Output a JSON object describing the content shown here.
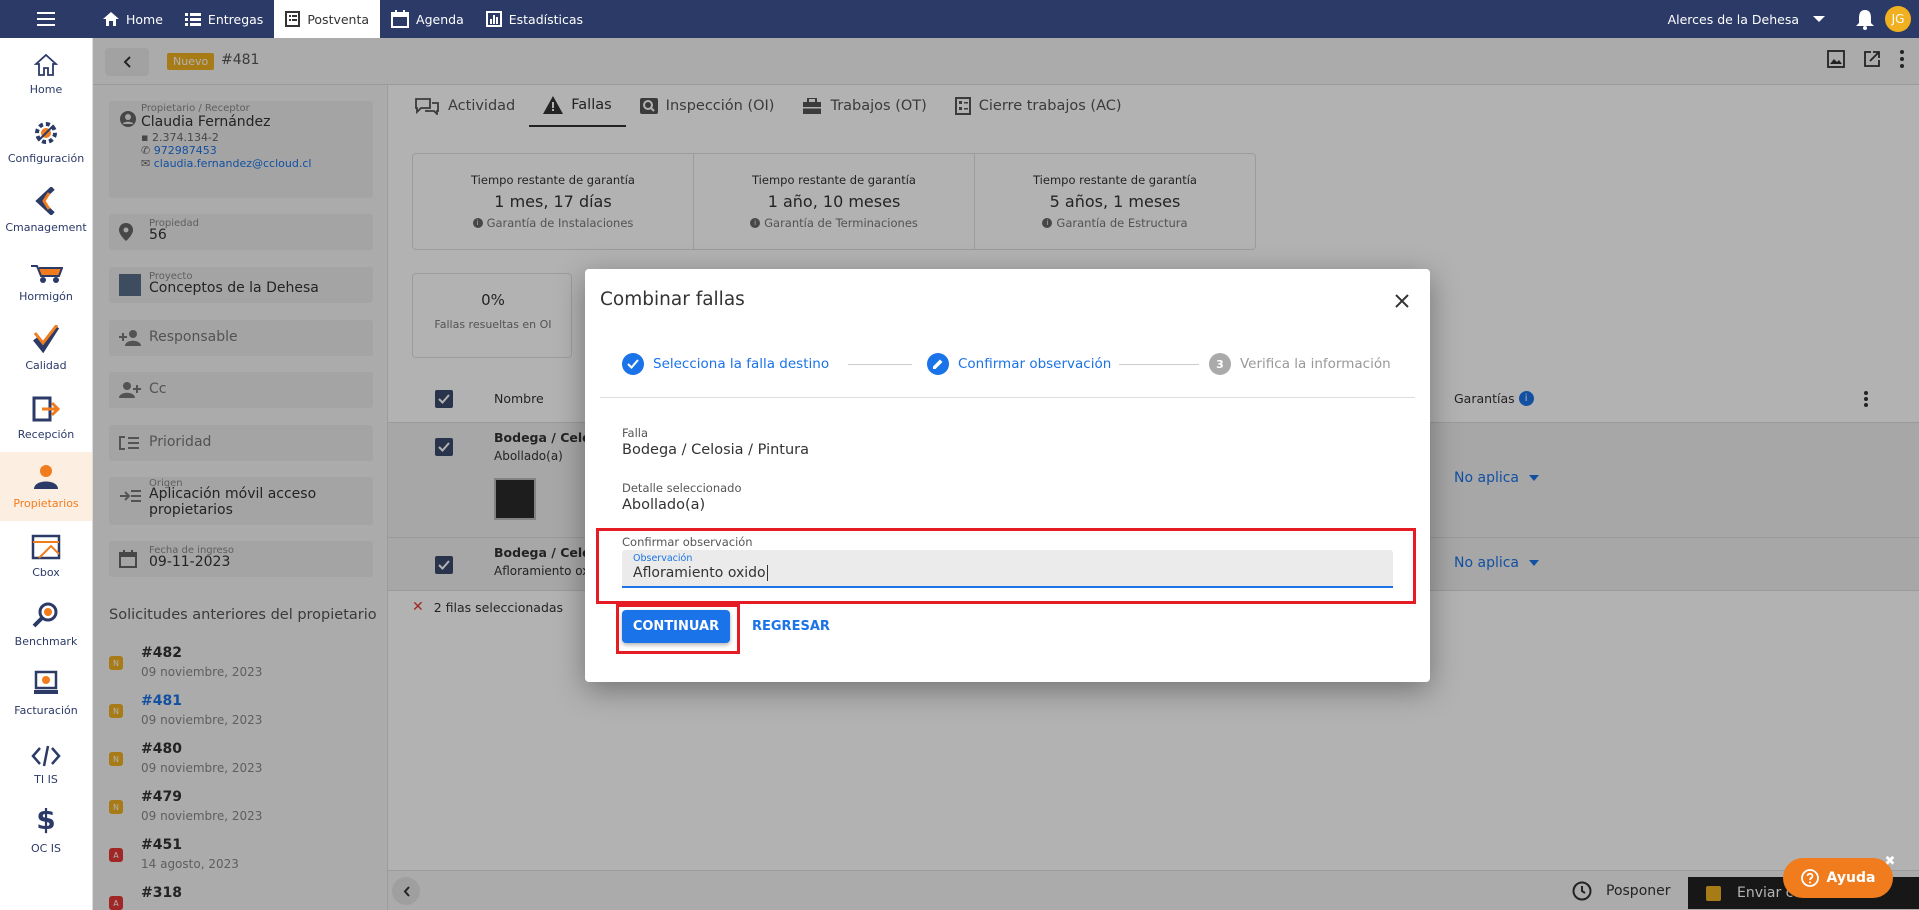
{
  "topbar": {
    "nav": [
      {
        "label": "Home",
        "icon": "home-icon"
      },
      {
        "label": "Entregas",
        "icon": "list-icon"
      },
      {
        "label": "Postventa",
        "icon": "document-icon"
      },
      {
        "label": "Agenda",
        "icon": "calendar-icon"
      },
      {
        "label": "Estadísticas",
        "icon": "bar-chart-icon"
      }
    ],
    "active_nav": "Postventa",
    "project_selector": "Alerces de la Dehesa",
    "avatar_initials": "JG"
  },
  "sidebar": {
    "items": [
      {
        "label": "Home",
        "icon": "home-icon"
      },
      {
        "label": "Configuración",
        "icon": "gear-icon"
      },
      {
        "label": "Cmanagement",
        "icon": "cmanagement-icon"
      },
      {
        "label": "Hormigón",
        "icon": "wheelbarrow-icon"
      },
      {
        "label": "Calidad",
        "icon": "check-icon"
      },
      {
        "label": "Recepción",
        "icon": "reception-icon"
      },
      {
        "label": "Propietarios",
        "icon": "owner-icon"
      },
      {
        "label": "Cbox",
        "icon": "cbox-icon"
      },
      {
        "label": "Benchmark",
        "icon": "benchmark-icon"
      },
      {
        "label": "Facturación",
        "icon": "billing-icon"
      },
      {
        "label": "TI IS",
        "icon": "code-icon"
      },
      {
        "label": "OC IS",
        "icon": "dollar-icon"
      }
    ],
    "active": "Propietarios"
  },
  "subbar": {
    "status": "Nuevo",
    "request_id": "#481"
  },
  "left_panel": {
    "owner": {
      "label": "Propietario / Receptor",
      "name": "Claudia Fernández",
      "rut": "2.374.134-2",
      "phone": "972987453",
      "email": "claudia.fernandez@ccloud.cl"
    },
    "property": {
      "label": "Propiedad",
      "value": "56"
    },
    "project": {
      "label": "Proyecto",
      "value": "Conceptos de la Dehesa"
    },
    "responsible": {
      "value": "Responsable"
    },
    "cc": {
      "value": "Cc"
    },
    "priority": {
      "value": "Prioridad"
    },
    "origin": {
      "label": "Origen",
      "value": "Aplicación móvil acceso propietarios"
    },
    "entry_date": {
      "label": "Fecha de ingreso",
      "value": "09-11-2023"
    },
    "previous_title": "Solicitudes anteriores del propietario",
    "previous": [
      {
        "badge": "N",
        "id": "#482",
        "date": "09 noviembre, 2023",
        "color": "#f0b020",
        "link": false
      },
      {
        "badge": "N",
        "id": "#481",
        "date": "09 noviembre, 2023",
        "color": "#f0b020",
        "link": true
      },
      {
        "badge": "N",
        "id": "#480",
        "date": "09 noviembre, 2023",
        "color": "#f0b020",
        "link": false
      },
      {
        "badge": "N",
        "id": "#479",
        "date": "09 noviembre, 2023",
        "color": "#f0b020",
        "link": false
      },
      {
        "badge": "A",
        "id": "#451",
        "date": "14 agosto, 2023",
        "color": "#e53935",
        "link": false
      },
      {
        "badge": "A",
        "id": "#318",
        "date": "",
        "color": "#e53935",
        "link": false
      }
    ]
  },
  "main": {
    "tabs": [
      {
        "label": "Actividad",
        "icon": "chat-icon"
      },
      {
        "label": "Fallas",
        "icon": "warning-icon"
      },
      {
        "label": "Inspección (OI)",
        "icon": "search-icon"
      },
      {
        "label": "Trabajos (OT)",
        "icon": "briefcase-icon"
      },
      {
        "label": "Cierre trabajos (AC)",
        "icon": "checklist-icon"
      }
    ],
    "active_tab": "Fallas",
    "warranties": [
      {
        "title": "Tiempo restante de garantía",
        "value": "1 mes, 17 días",
        "sub": "Garantía de Instalaciones"
      },
      {
        "title": "Tiempo restante de garantía",
        "value": "1 año, 10 meses",
        "sub": "Garantía de Terminaciones"
      },
      {
        "title": "Tiempo restante de garantía",
        "value": "5 años, 1 meses",
        "sub": "Garantía de Estructura"
      }
    ],
    "stat": {
      "value": "0%",
      "label": "Fallas resueltas en OI"
    },
    "table": {
      "col_name": "Nombre",
      "col_guarantees": "Garantías",
      "rows": [
        {
          "name": "Bodega / Celos",
          "detail": "Abollado(a)",
          "guarantee": "No aplica"
        },
        {
          "name": "Bodega / Celos",
          "detail": "Afloramiento ox",
          "guarantee": "No aplica"
        }
      ],
      "selected_text": "2 filas seleccionadas"
    },
    "bottom": {
      "postpone": "Posponer",
      "send": "Enviar co"
    }
  },
  "modal": {
    "title": "Combinar fallas",
    "steps": [
      {
        "label": "Selecciona la falla destino",
        "state": "done"
      },
      {
        "label": "Confirmar observación",
        "state": "active"
      },
      {
        "label": "Verifica la información",
        "state": "pending",
        "number": "3"
      }
    ],
    "falla_label": "Falla",
    "falla_value": "Bodega / Celosia / Pintura",
    "detalle_label": "Detalle seleccionado",
    "detalle_value": "Abollado(a)",
    "confirm_label": "Confirmar observación",
    "obs_label": "Observación",
    "obs_value": "Afloramiento oxido",
    "continue_label": "CONTINUAR",
    "back_label": "REGRESAR"
  },
  "help": {
    "label": "Ayuda"
  },
  "colors": {
    "topbar": "#2b3a67",
    "accent": "#1a73e8",
    "highlight": "#e51c23",
    "active_side": "#f07c1e"
  }
}
